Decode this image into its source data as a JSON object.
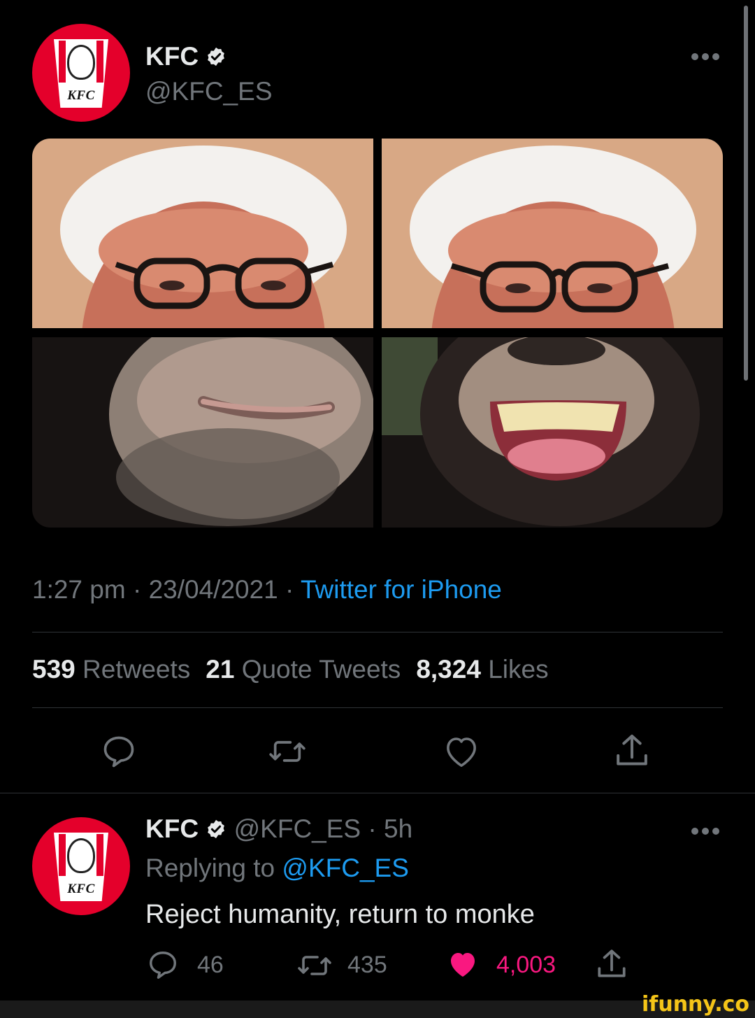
{
  "tweet": {
    "display_name": "KFC",
    "handle": "@KFC_ES",
    "avatar_label": "KFC",
    "time_meta": "1:27 pm · 23/04/2021 · ",
    "source": "Twitter for iPhone",
    "stats": {
      "retweets_count": "539",
      "retweets_label": "Retweets",
      "quotes_count": "21",
      "quotes_label": "Quote Tweets",
      "likes_count": "8,324",
      "likes_label": "Likes"
    }
  },
  "reply": {
    "display_name": "KFC",
    "handle_time": "@KFC_ES · 5h",
    "avatar_label": "KFC",
    "replying_prefix": "Replying to ",
    "replying_handle": "@KFC_ES",
    "text": "Reject humanity, return to monke",
    "reply_count": "46",
    "retweet_count": "435",
    "like_count": "4,003"
  },
  "colors": {
    "background": "#000000",
    "link_blue": "#1d9bf0",
    "like_pink": "#f91880",
    "kfc_red": "#e4002b",
    "muted_text": "#71767b"
  },
  "watermark": "ifunny.co"
}
